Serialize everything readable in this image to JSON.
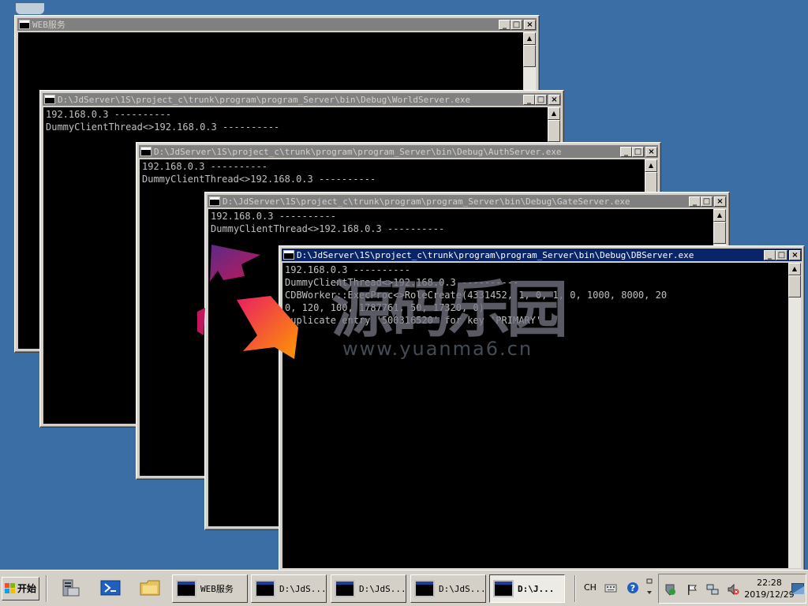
{
  "desktop": {
    "background": "#3a6ea5"
  },
  "windows": [
    {
      "id": "web",
      "title": "WEB服务",
      "lines": []
    },
    {
      "id": "world",
      "title": "D:\\JdServer\\1S\\project_c\\trunk\\program\\program_Server\\bin\\Debug\\WorldServer.exe",
      "lines": [
        "192.168.0.3 ----------",
        "DummyClientThread<>192.168.0.3 ----------"
      ]
    },
    {
      "id": "auth",
      "title": "D:\\JdServer\\1S\\project_c\\trunk\\program\\program_Server\\bin\\Debug\\AuthServer.exe",
      "lines": [
        "192.168.0.3 ----------",
        "DummyClientThread<>192.168.0.3 ----------"
      ]
    },
    {
      "id": "gate",
      "title": "D:\\JdServer\\1S\\project_c\\trunk\\program\\program_Server\\bin\\Debug\\GateServer.exe",
      "lines": [
        "192.168.0.3 ----------",
        "DummyClientThread<>192.168.0.3 ----------"
      ]
    },
    {
      "id": "db",
      "title": "D:\\JdServer\\1S\\project_c\\trunk\\program\\program_Server\\bin\\Debug\\DBServer.exe",
      "lines": [
        "192.168.0.3 ----------",
        "DummyClientThread<>192.168.0.3 ----------",
        "CDBWorker::ExecProc<>RoleCreate(4331452, 1, 0, 1, 0, 1000, 8000, 20",
        "0, 120, 100, 1787761, 50, 17320, 0)",
        "Duplicate entry '500316520' for key 'PRIMARY'"
      ]
    }
  ],
  "window_buttons": {
    "minimize": "_",
    "maximize": "□",
    "close": "×"
  },
  "watermark": {
    "text": "www.yuanma6.cn",
    "chinese": "源码乐园"
  },
  "taskbar": {
    "start_label": "开始",
    "quick_launch": [
      "server-manager-icon",
      "powershell-icon",
      "explorer-icon"
    ],
    "buttons": [
      {
        "label": "WEB服务",
        "active": false
      },
      {
        "label": "D:\\JdS...",
        "active": false
      },
      {
        "label": "D:\\JdS...",
        "active": false
      },
      {
        "label": "D:\\JdS...",
        "active": false
      },
      {
        "label": "D:\\J...",
        "active": true
      }
    ],
    "language": "CH",
    "clock_time": "22:28",
    "clock_date": "2019/12/29"
  }
}
